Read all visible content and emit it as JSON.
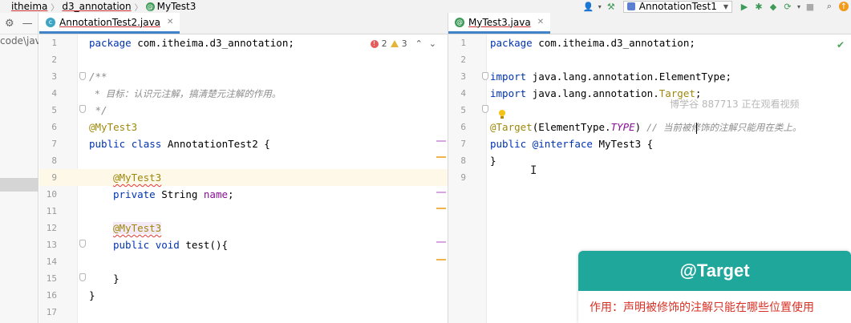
{
  "navbar": {
    "breadcrumbs": [
      {
        "label": "itheima"
      },
      {
        "label": "d3_annotation"
      },
      {
        "label": "MyTest3"
      }
    ],
    "run_config": "AnnotationTest1"
  },
  "sidebar": {
    "path_text": "code\\java"
  },
  "left_editor": {
    "tab_label": "AnnotationTest2.java",
    "errors": "2",
    "warnings": "3",
    "lines": [
      {
        "n": "1",
        "code": "package com.itheima.d3_annotation;"
      },
      {
        "n": "2",
        "code": ""
      },
      {
        "n": "3",
        "code": "/**"
      },
      {
        "n": "4",
        "code": " * 目标：认识元注解，搞清楚元注解的作用。"
      },
      {
        "n": "5",
        "code": " */"
      },
      {
        "n": "6",
        "code": "@MyTest3"
      },
      {
        "n": "7",
        "code": "public class AnnotationTest2 {"
      },
      {
        "n": "8",
        "code": ""
      },
      {
        "n": "9",
        "code": "    @MyTest3"
      },
      {
        "n": "10",
        "code": "    private String name;"
      },
      {
        "n": "11",
        "code": ""
      },
      {
        "n": "12",
        "code": "    @MyTest3"
      },
      {
        "n": "13",
        "code": "    public void test(){"
      },
      {
        "n": "14",
        "code": ""
      },
      {
        "n": "15",
        "code": "    }"
      },
      {
        "n": "16",
        "code": "}"
      },
      {
        "n": "17",
        "code": ""
      }
    ],
    "tokens": {
      "pkg_kw": "package",
      "pkg_name": " com.itheima.d3_annotation;",
      "doc_open": "/**",
      "doc_line": " * 目标：认识元注解，搞清楚元注解的作用。",
      "doc_close": " */",
      "anno": "@MyTest3",
      "public": "public",
      "class": "class",
      "class_name": " AnnotationTest2 {",
      "private": "private",
      "string": "String",
      "field": "name",
      "semi": ";",
      "void": "void",
      "method": "test(){",
      "close_method": "    }",
      "close_class": "}"
    }
  },
  "right_editor": {
    "tab_label": "MyTest3.java",
    "line_numbers": [
      "1",
      "2",
      "3",
      "4",
      "5",
      "6",
      "7",
      "8",
      "9"
    ],
    "tokens": {
      "pkg_kw": "package",
      "pkg_name": " com.itheima.d3_annotation;",
      "import": "import",
      "import1": " java.lang.annotation.ElementType;",
      "import2_a": " java.lang.annotation.",
      "import2_b": "Target",
      "import2_c": ";",
      "target_anno": "@Target",
      "target_arg_a": "(ElementType.",
      "target_arg_b": "TYPE",
      "target_arg_c": ")",
      "comment_a": " // 当前",
      "comment_b": "被修饰的注解只能用在类上。",
      "public": "public",
      "interface_kw": " @interface",
      "iface_name": " MyTest3 {",
      "close": "}"
    },
    "watermark": "博学谷 887713 正在观看视频"
  },
  "card": {
    "title": "@Target",
    "description": "作用：声明被修饰的注解只能在哪些位置使用"
  },
  "colors": {
    "card_header": "#1fa79c",
    "card_text": "#d93025",
    "keyword": "#0033b3",
    "annotation": "#9e880d",
    "tab_underline": "#4083c9"
  }
}
